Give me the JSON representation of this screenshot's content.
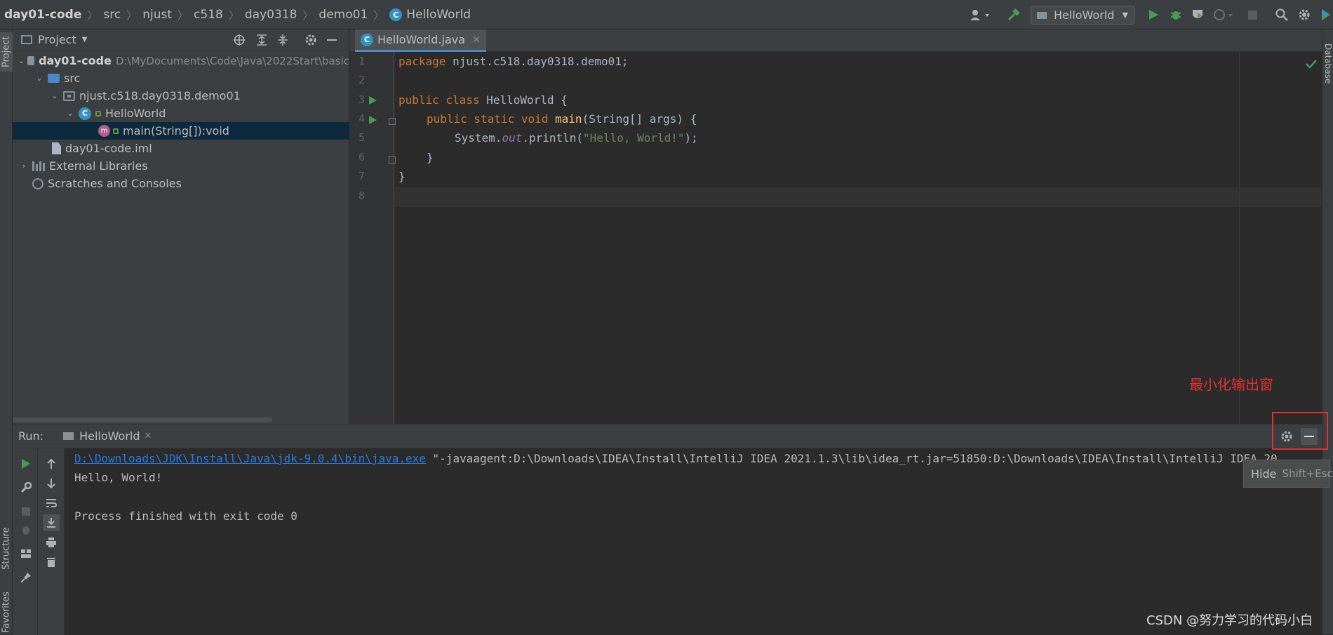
{
  "breadcrumbs": [
    "day01-code",
    "src",
    "njust",
    "c518",
    "day0318",
    "demo01",
    "HelloWorld"
  ],
  "run_config": {
    "name": "HelloWorld"
  },
  "left_strip": {
    "top_label": "Project",
    "structure_label": "Structure",
    "favorites_label": "Favorites"
  },
  "right_strip": {
    "label": "Database"
  },
  "project_panel": {
    "title": "Project",
    "tree": [
      {
        "label": "day01-code",
        "path": "D:\\MyDocuments\\Code\\Java\\2022Start\\basic",
        "type": "module"
      },
      {
        "label": "src",
        "type": "source-folder"
      },
      {
        "label": "njust.c518.day0318.demo01",
        "type": "package"
      },
      {
        "label": "HelloWorld",
        "type": "class"
      },
      {
        "label": "main(String[]):void",
        "type": "method"
      },
      {
        "label": "day01-code.iml",
        "type": "file"
      },
      {
        "label": "External Libraries",
        "type": "libraries"
      },
      {
        "label": "Scratches and Consoles",
        "type": "scratches"
      }
    ]
  },
  "editor": {
    "tab": "HelloWorld.java",
    "line_numbers": [
      "1",
      "2",
      "3",
      "4",
      "5",
      "6",
      "7",
      "8"
    ],
    "code": {
      "l1_kw": "package",
      "l1_rest": " njust.c518.day0318.demo01;",
      "l3_kw": "public class",
      "l3_rest": " HelloWorld {",
      "l4_kw": "public static void",
      "l4_fn": "main",
      "l4_rest": "(String[] args) {",
      "l5_a": "System.",
      "l5_it": "out",
      "l5_b": ".println(",
      "l5_str": "\"Hello, World!\"",
      "l5_c": ");",
      "l6": "}",
      "l7": "}"
    }
  },
  "run_panel": {
    "label": "Run:",
    "tab": "HelloWorld",
    "console": {
      "cmd_link": "D:\\Downloads\\JDK\\Install\\Java\\jdk-9.0.4\\bin\\java.exe",
      "cmd_rest": " \"-javaagent:D:\\Downloads\\IDEA\\Install\\IntelliJ IDEA 2021.1.3\\lib\\idea_rt.jar=51850:D:\\Downloads\\IDEA\\Install\\IntelliJ IDEA 20",
      "out1": "Hello, World!",
      "out2": "Process finished with exit code 0"
    }
  },
  "tooltip": {
    "text": "Hide",
    "shortcut": "Shift+Esc"
  },
  "annotation": "最小化输出窗",
  "watermark": "CSDN @努力学习的代码小白",
  "colors": {
    "accent": "#4a88c7",
    "run_green": "#499c54",
    "annotation_red": "#e5302f"
  }
}
